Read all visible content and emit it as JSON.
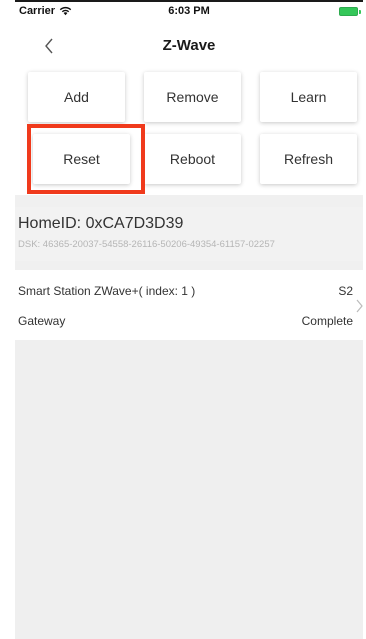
{
  "status_bar": {
    "carrier": "Carrier",
    "time": "6:03 PM"
  },
  "nav": {
    "title": "Z-Wave",
    "back_icon": "chevron-left-icon"
  },
  "actions": {
    "add": "Add",
    "remove": "Remove",
    "learn": "Learn",
    "reset": "Reset",
    "reboot": "Reboot",
    "refresh": "Refresh"
  },
  "highlight_color": "#f03a1c",
  "home": {
    "home_id": "HomeID: 0xCA7D3D39",
    "dsk": "DSK: 46365-20037-54558-26116-50206-49354-61157-02257"
  },
  "device": {
    "name": "Smart Station ZWave+( index: 1 )",
    "security": "S2",
    "type": "Gateway",
    "status": "Complete"
  }
}
